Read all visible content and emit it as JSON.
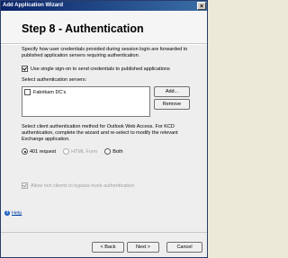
{
  "window": {
    "title": "Add Application Wizard",
    "close_glyph": "×"
  },
  "header": {
    "step_title": "Step 8 - Authentication"
  },
  "main": {
    "description": "Specify how user credentials provided during session login are forwarded to published application servers requiring authentication.",
    "sso_checkbox_label": "Use single sign-on to send credentials to published applications",
    "servers_label": "Select authentication servers:",
    "servers": [
      {
        "label": "Fabrikam DC's",
        "checked": false
      }
    ],
    "add_button": "Add...",
    "remove_button": "Remove",
    "client_auth_text": "Select client authentication method for Outlook Web Access. For KCD authentication, complete the wizard and re-select to modify the relevant Exchange application.",
    "radio_options": [
      {
        "label": "401 request",
        "selected": true,
        "enabled": true
      },
      {
        "label": "HTML Form",
        "selected": false,
        "enabled": false
      },
      {
        "label": "Both",
        "selected": false,
        "enabled": true
      }
    ],
    "rich_clients_label": "Allow rich clients to bypass trunk authentication"
  },
  "help": {
    "label": "Help",
    "icon_glyph": "?"
  },
  "footer": {
    "back_button": "< Back",
    "next_button": "Next >",
    "cancel_button": "Cancel"
  }
}
